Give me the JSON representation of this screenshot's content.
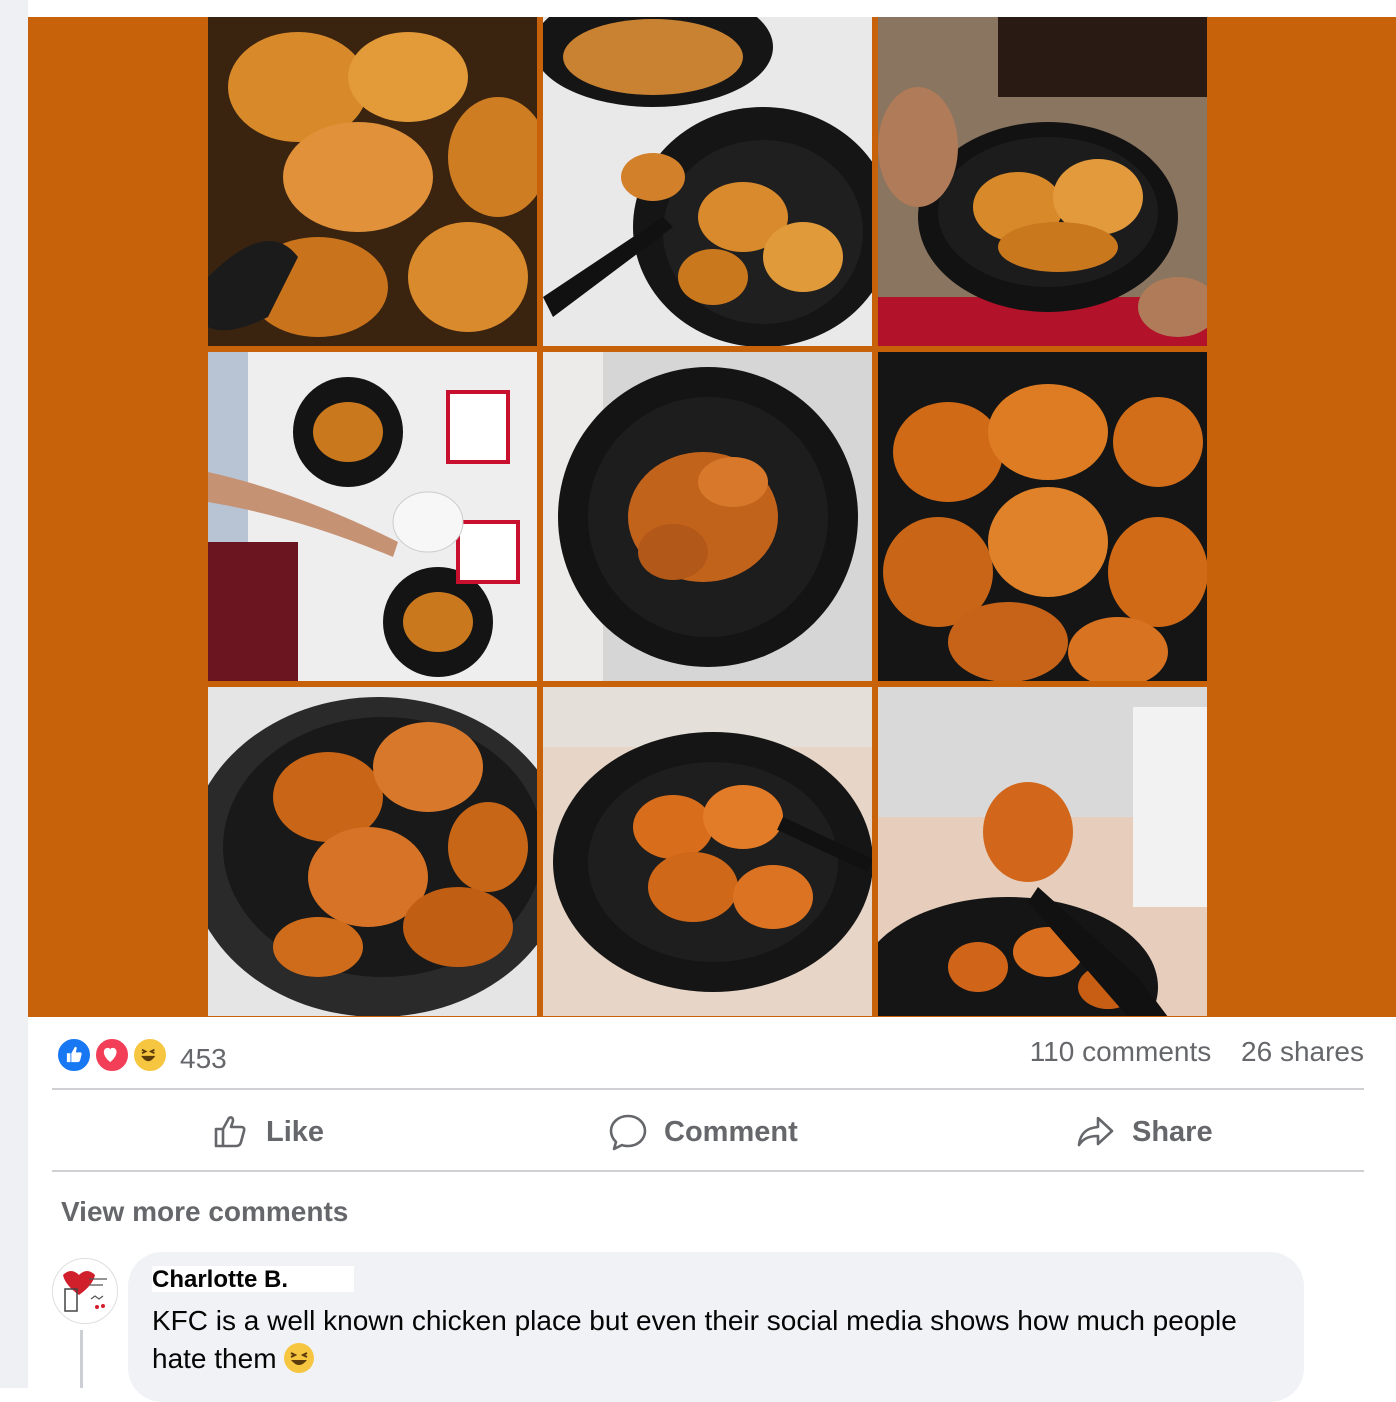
{
  "post": {
    "media_alt": "Grid of nine photos of sauced fried chicken pieces in black bowls",
    "colors": {
      "media_background": "#c8620a",
      "like_blue": "#1877f2",
      "love_red": "#f33e58",
      "haha_yellow": "#f7c640"
    },
    "reactions": {
      "icons": [
        "like-icon",
        "love-icon",
        "haha-icon"
      ],
      "count": "453"
    },
    "comments_count": "110 comments",
    "shares_count": "26 shares"
  },
  "actions": {
    "like": "Like",
    "comment": "Comment",
    "share": "Share"
  },
  "comments": {
    "view_more": "View more comments",
    "items": [
      {
        "author": "Charlotte B.",
        "text": "KFC is a well known chicken place but even their social media shows how much people hate them"
      }
    ]
  }
}
